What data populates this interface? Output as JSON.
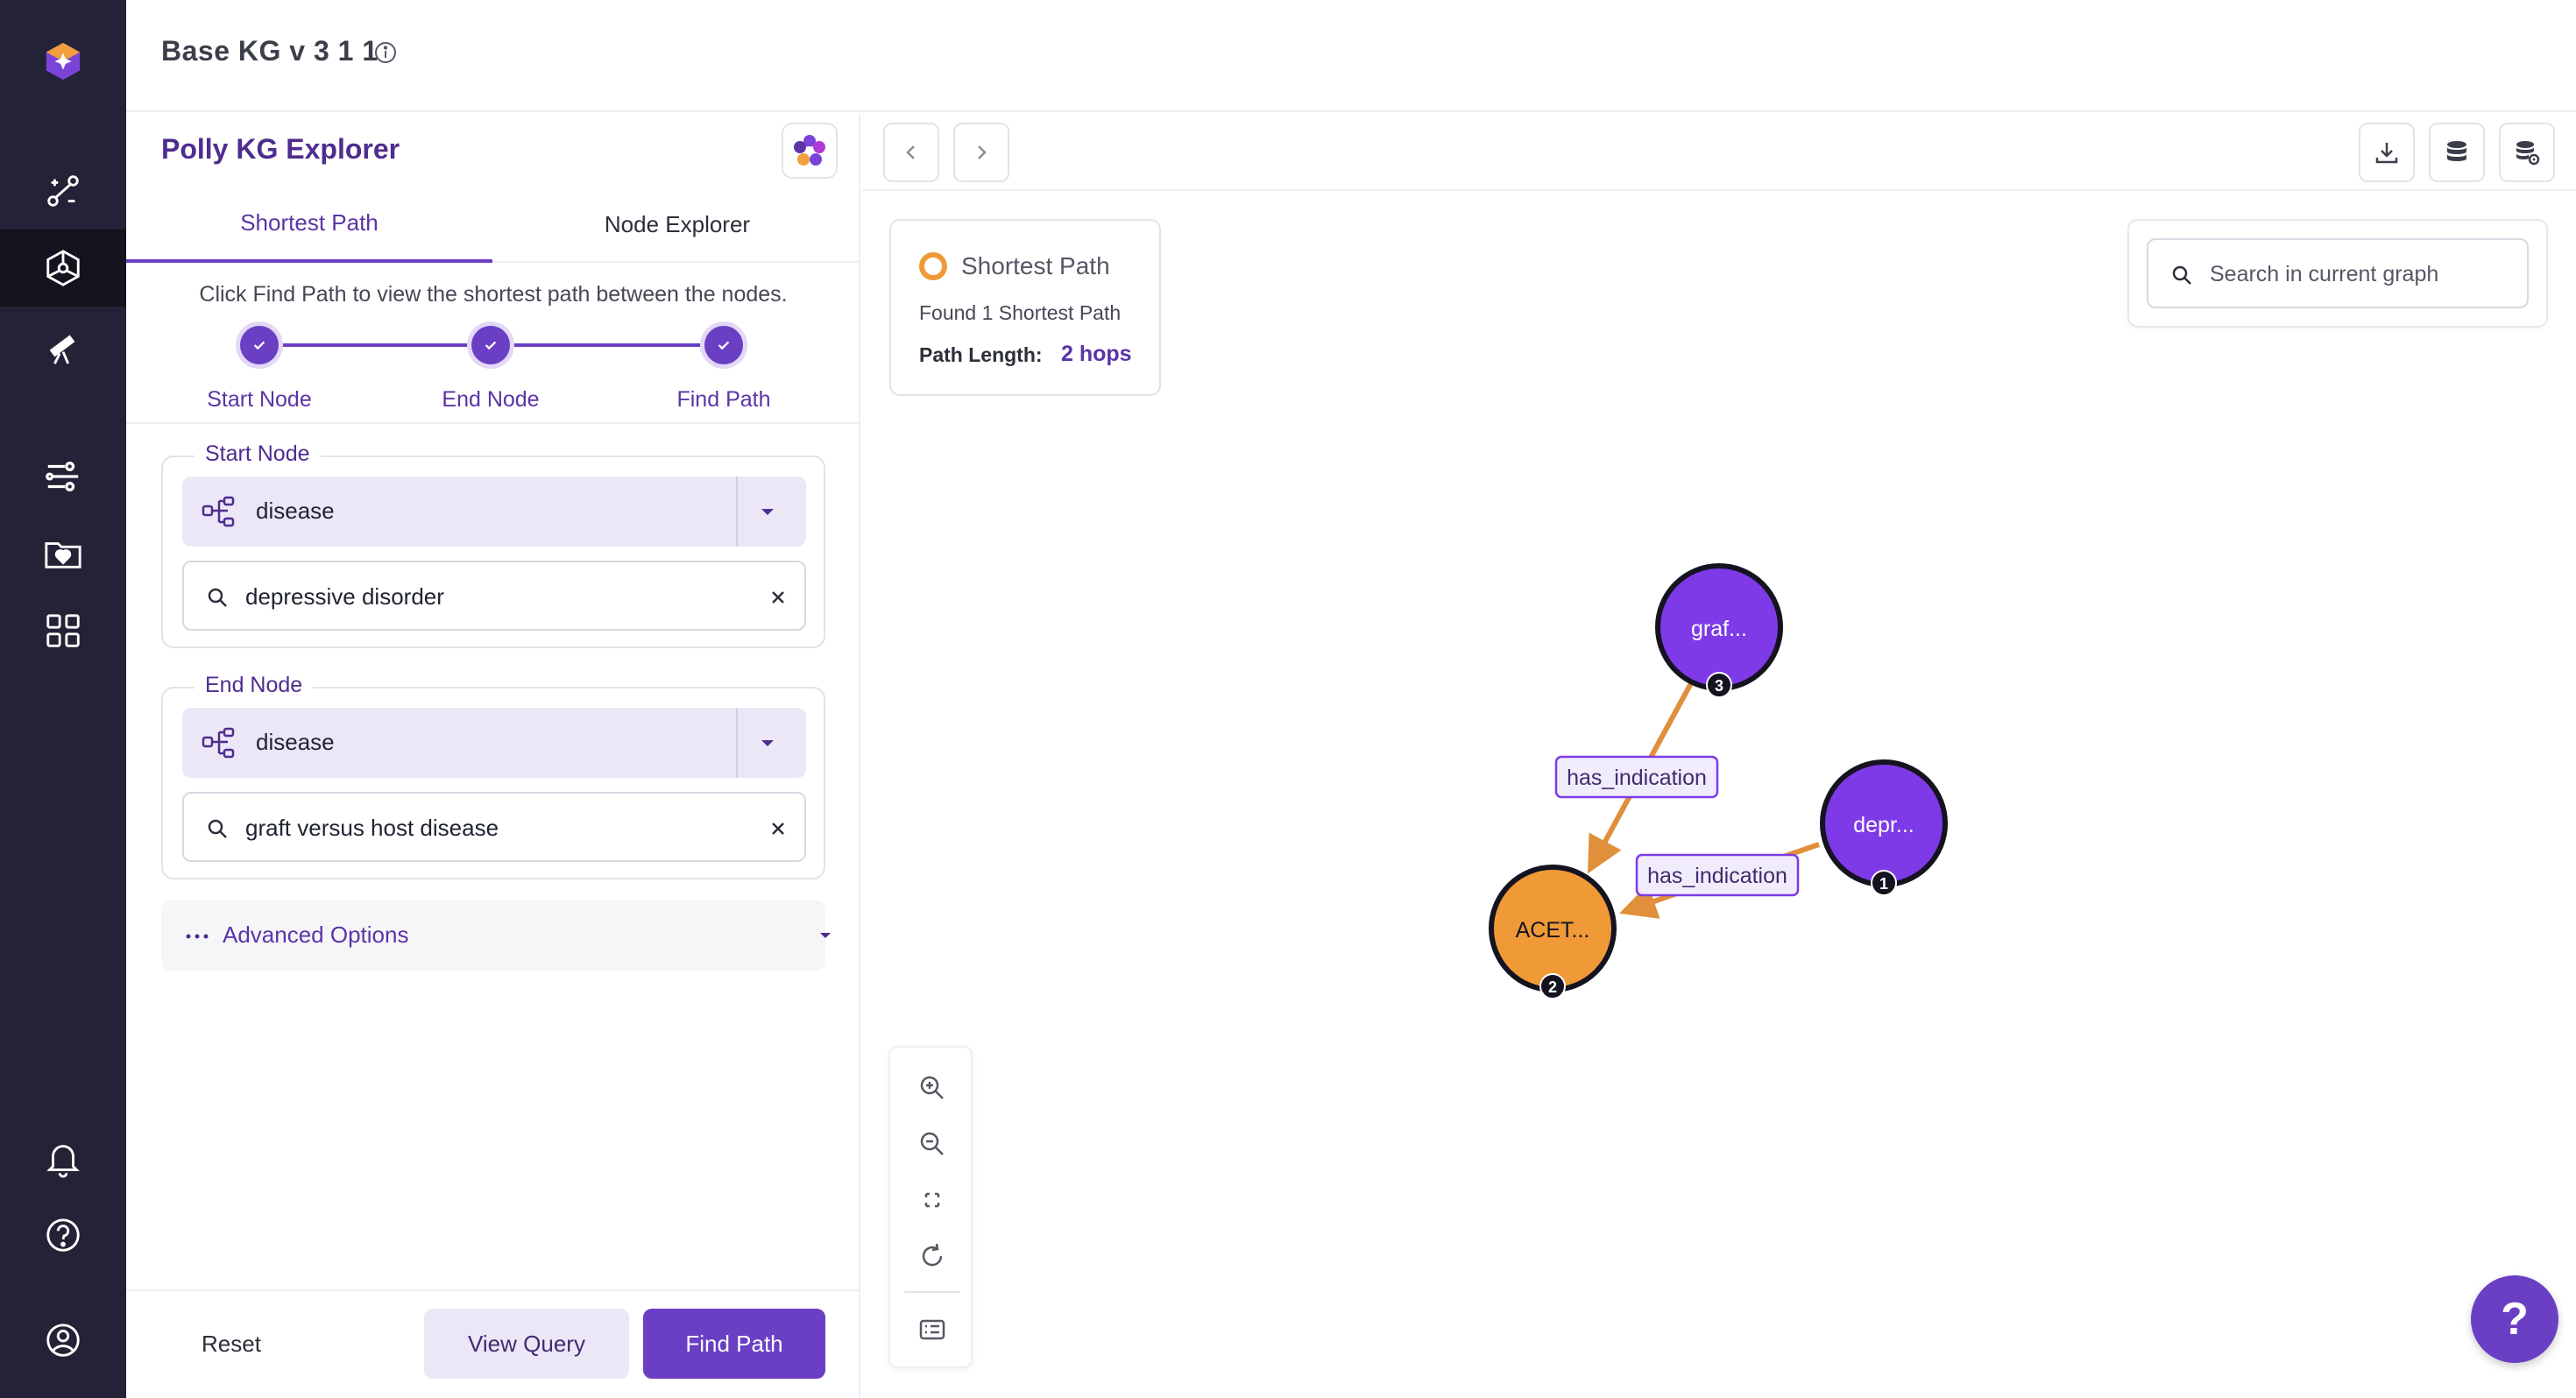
{
  "header": {
    "title": "Base KG v 3 1 1"
  },
  "panel": {
    "title": "Polly KG Explorer",
    "tabs": [
      {
        "label": "Shortest Path",
        "active": true
      },
      {
        "label": "Node Explorer",
        "active": false
      }
    ],
    "instructions": "Click Find Path to view the shortest path between the nodes.",
    "steps": [
      {
        "label": "Start Node",
        "done": true
      },
      {
        "label": "End Node",
        "done": true
      },
      {
        "label": "Find Path",
        "done": true
      }
    ],
    "start_node": {
      "legend": "Start Node",
      "type": "disease",
      "value": "depressive disorder"
    },
    "end_node": {
      "legend": "End Node",
      "type": "disease",
      "value": "graft versus host disease"
    },
    "advanced_label": "Advanced Options",
    "buttons": {
      "reset": "Reset",
      "view_query": "View Query",
      "find_path": "Find Path"
    }
  },
  "summary": {
    "title": "Shortest Path",
    "found": "Found 1 Shortest Path",
    "path_length_label": "Path Length:",
    "path_length_value": "2 hops"
  },
  "graph_search": {
    "placeholder": "Search in current graph",
    "value": ""
  },
  "graph": {
    "nodes": [
      {
        "id": "n3",
        "label": "graf...",
        "order": "3",
        "color": "#7e3ae6"
      },
      {
        "id": "n1",
        "label": "depr...",
        "order": "1",
        "color": "#7e3ae6"
      },
      {
        "id": "n2",
        "label": "ACET...",
        "order": "2",
        "color": "#ef9a37"
      }
    ],
    "edges": [
      {
        "from": "n3",
        "to": "n2",
        "label": "has_indication"
      },
      {
        "from": "n1",
        "to": "n2",
        "label": "has_indication"
      }
    ],
    "edge_color": "#e08f3a"
  },
  "colors": {
    "accent": "#6a3fc4",
    "rail": "#232236",
    "path": "#ef9a37"
  },
  "help": {
    "label": "?"
  }
}
